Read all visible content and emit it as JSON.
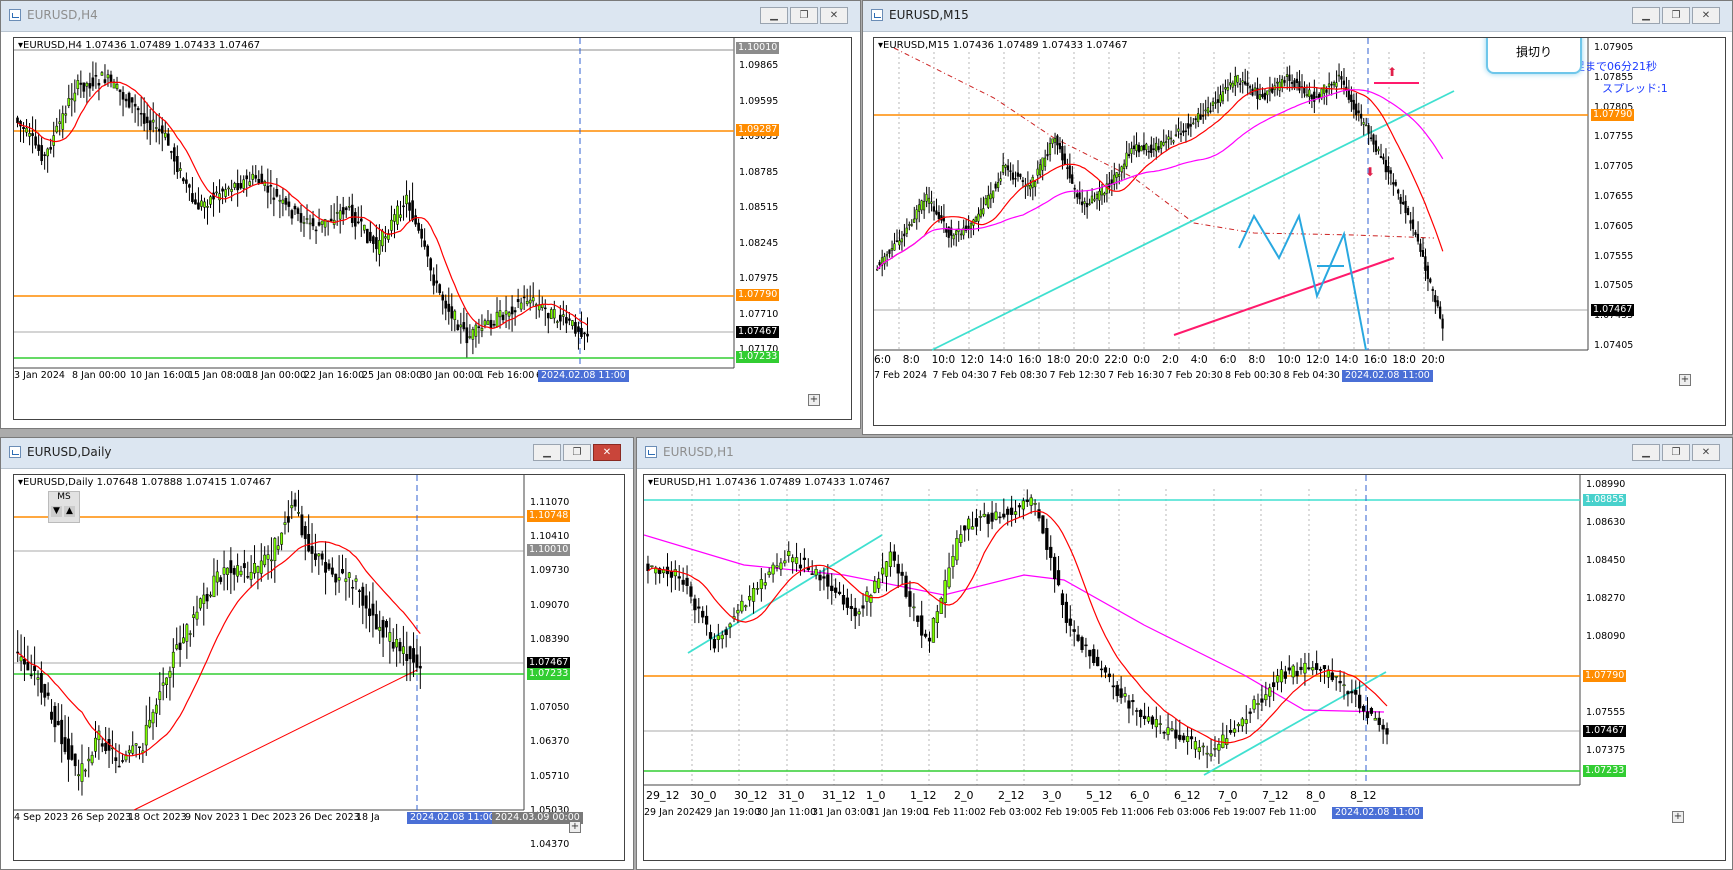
{
  "windows": {
    "h4": {
      "title": "EURUSD,H4",
      "info": "EURUSD,H4  1.07436 1.07489 1.07433 1.07467",
      "y_labels": [
        "1.09865",
        "1.09595",
        "1.09055",
        "1.08785",
        "1.08515",
        "1.08245",
        "1.07975",
        "1.07710",
        "1.07170"
      ],
      "tags": [
        {
          "text": "1.10010",
          "color": "#8c8c8c"
        },
        {
          "text": "1.09287",
          "color": "#ff8c00"
        },
        {
          "text": "1.07790",
          "color": "#ff8c00"
        },
        {
          "text": "1.07467",
          "color": "#ffffff"
        },
        {
          "text": "1.07233",
          "color": "#32cd32"
        }
      ],
      "x_labels": [
        "3 Jan 2024",
        "8 Jan 00:00",
        "10 Jan 16:00",
        "15 Jan 08:00",
        "18 Jan 00:00",
        "22 Jan 16:00",
        "25 Jan 08:00",
        "30 Jan 00:00",
        "1 Feb 16:00",
        "6"
      ],
      "cursor_time": "2024.02.08 11:00"
    },
    "m15": {
      "title": "EURUSD,M15",
      "info": "EURUSD,M15  1.07436 1.07489 1.07433 1.07467",
      "y_labels": [
        "1.07905",
        "1.07855",
        "1.07805",
        "1.07755",
        "1.07705",
        "1.07655",
        "1.07605",
        "1.07555",
        "1.07505",
        "1.07455",
        "1.07405"
      ],
      "tags": [
        {
          "text": "1.07790",
          "color": "#ff8c00"
        },
        {
          "text": "1.07467",
          "color": "#ffffff"
        }
      ],
      "hour_labels": [
        "6:0",
        "8:0",
        "10:0",
        "12:0",
        "14:0",
        "16:0",
        "18:0",
        "20:0",
        "22:0",
        "0:0",
        "2:0",
        "4:0",
        "6:0",
        "8:0",
        "10:0",
        "12:0",
        "14:0",
        "16:0",
        "18:0",
        "20:0"
      ],
      "x_labels": [
        "7 Feb 2024",
        "7 Feb 04:30",
        "7 Feb 08:30",
        "7 Feb 12:30",
        "7 Feb 16:30",
        "7 Feb 20:30",
        "8 Feb 00:30",
        "8 Feb 04:30",
        "b 12:30"
      ],
      "cursor_time": "2024.02.08 11:00",
      "countdown_text": "足まで06分21秒",
      "spread_text": "スプレッド:1",
      "callout_text": "損切り"
    },
    "daily": {
      "title": "EURUSD,Daily",
      "info": "EURUSD,Daily  1.07648 1.07888 1.07415 1.07467",
      "ms_label": "MS",
      "y_labels": [
        "1.11070",
        "1.10410",
        "1.09730",
        "1.09070",
        "1.08390",
        "1.07710",
        "1.07050",
        "1.06370",
        "1.05710",
        "1.05030",
        "1.04370"
      ],
      "tags": [
        {
          "text": "1.10748",
          "color": "#ff8c00"
        },
        {
          "text": "1.10010",
          "color": "#8c8c8c"
        },
        {
          "text": "1.07467",
          "color": "#ffffff"
        },
        {
          "text": "1.07233",
          "color": "#32cd32"
        }
      ],
      "x_labels": [
        "4 Sep 2023",
        "26 Sep 2023",
        "18 Oct 2023",
        "9 Nov 2023",
        "1 Dec 2023",
        "26 Dec 2023",
        "18 Ja"
      ],
      "cursor_time": "2024.02.08 11:00",
      "end_time": "2024.03.09 00:00"
    },
    "h1": {
      "title": "EURUSD,H1",
      "info": "EURUSD,H1  1.07436 1.07489 1.07433 1.07467",
      "y_labels": [
        "1.08990",
        "1.08630",
        "1.08450",
        "1.08270",
        "1.08090",
        "1.07735",
        "1.07555",
        "1.07375"
      ],
      "tags": [
        {
          "text": "1.08855",
          "color": "#48d1cc"
        },
        {
          "text": "1.07790",
          "color": "#ff8c00"
        },
        {
          "text": "1.07467",
          "color": "#ffffff"
        },
        {
          "text": "1.07233",
          "color": "#32cd32"
        }
      ],
      "day_labels": [
        "29_12",
        "30_0",
        "30_12",
        "31_0",
        "31_12",
        "1_0",
        "1_12",
        "2_0",
        "2_12",
        "3_0",
        "5_12",
        "6_0",
        "6_12",
        "7_0",
        "7_12",
        "8_0",
        "8_12"
      ],
      "x_labels": [
        "29 Jan 2024",
        "29 Jan 19:00",
        "30 Jan 11:00",
        "31 Jan 03:00",
        "31 Jan 19:00",
        "1 Feb 11:00",
        "2 Feb 03:00",
        "2 Feb 19:00",
        "5 Feb 11:00",
        "6 Feb 03:00",
        "6 Feb 19:00",
        "7 Feb 11:00"
      ],
      "cursor_time": "2024.02.08 11:00"
    }
  },
  "colors": {
    "bull_candle": "#7cfc00",
    "bear_candle": "#000000",
    "ma_red": "#ff0000",
    "ma_magenta": "#ff00ff",
    "level_orange": "#ff8c00",
    "level_green": "#32cd32",
    "trend_cyan": "#40e0d0",
    "trend_pink": "#ff1a6c",
    "cursor_blue": "#3060d0",
    "titlebar": "#dce6f1",
    "desktop": "#ababab"
  },
  "icons": [
    "chart-window-icon",
    "minimize-icon",
    "restore-icon",
    "close-icon",
    "dropdown-triangle-icon",
    "arrow-up-icon",
    "arrow-down-icon",
    "plus-icon"
  ]
}
